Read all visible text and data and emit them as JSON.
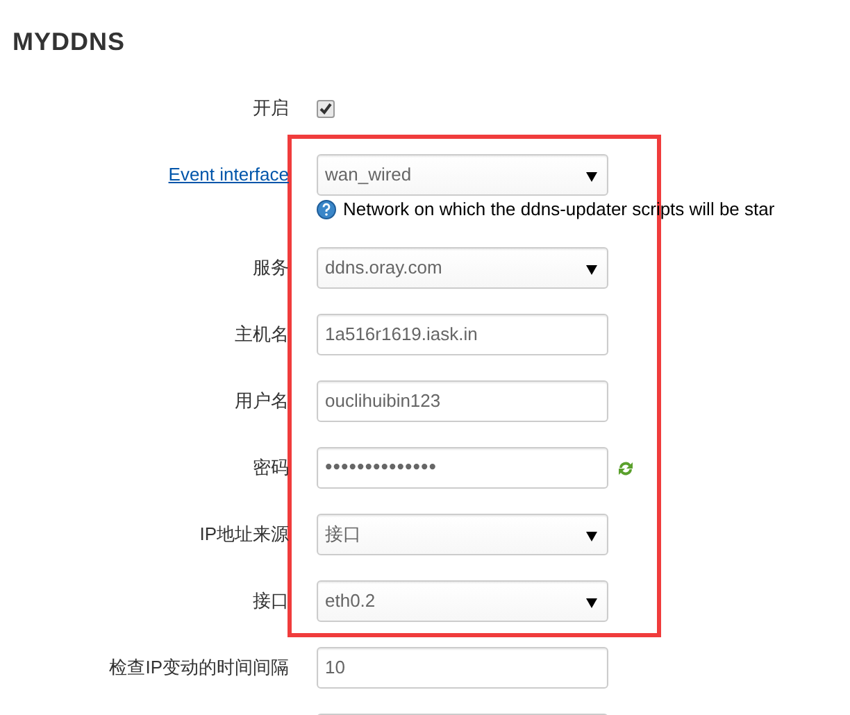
{
  "title": "MYDDNS",
  "fields": [
    {
      "kind": "checkbox",
      "label": "开启",
      "checked": true
    },
    {
      "kind": "select",
      "label": "Event interface",
      "label_link": true,
      "value": "wan_wired",
      "help": "Network on which the ddns-updater scripts will be star"
    },
    {
      "kind": "select",
      "label": "服务",
      "value": "ddns.oray.com"
    },
    {
      "kind": "text",
      "label": "主机名",
      "value": "1a516r1619.iask.in"
    },
    {
      "kind": "text",
      "label": "用户名",
      "value": "ouclihuibin123"
    },
    {
      "kind": "password",
      "label": "密码",
      "value": "••••••••••••••"
    },
    {
      "kind": "select",
      "label": "IP地址来源",
      "value": "接口"
    },
    {
      "kind": "select",
      "label": "接口",
      "value": "eth0.2"
    },
    {
      "kind": "text",
      "label": "检查IP变动的时间间隔",
      "value": "10"
    },
    {
      "kind": "text"
    }
  ]
}
